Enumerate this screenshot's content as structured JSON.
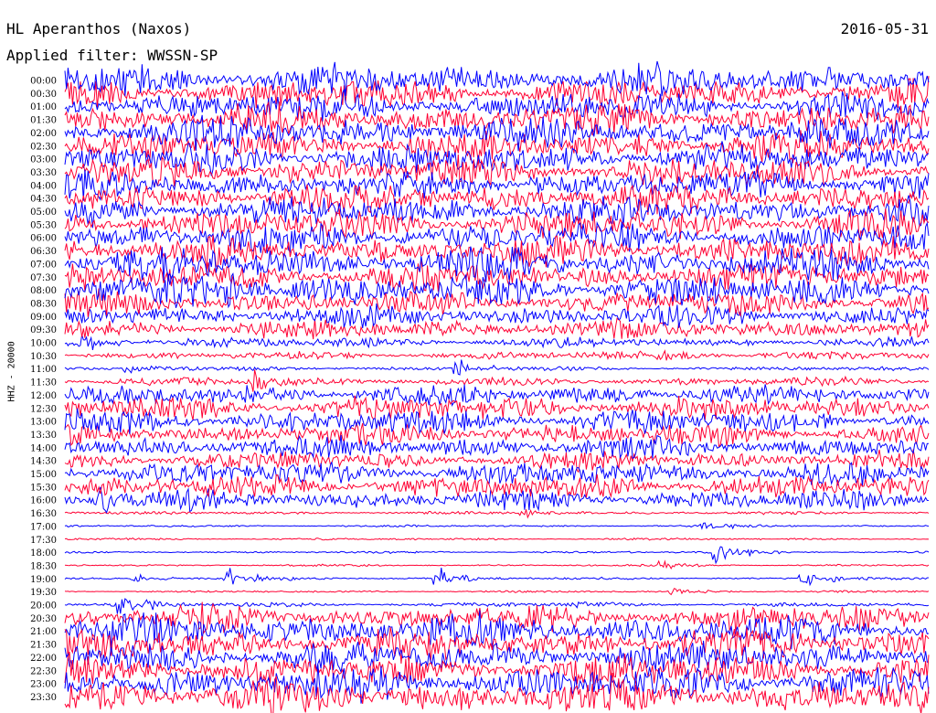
{
  "header": {
    "station": "HL Aperanthos (Naxos)",
    "date": "2016-05-31",
    "filter": "Applied filter: WWSSN-SP"
  },
  "chart_data": {
    "type": "line",
    "title": "HL Aperanthos (Naxos)",
    "ylabel": "HHZ - 20000",
    "colors": [
      "#0000ff",
      "#ff0033"
    ],
    "x_axis": "minutes within 30-minute trace line (0-30)",
    "grid": false,
    "legend": "none",
    "categories": [
      "00:00",
      "00:30",
      "01:00",
      "01:30",
      "02:00",
      "02:30",
      "03:00",
      "03:30",
      "04:00",
      "04:30",
      "05:00",
      "05:30",
      "06:00",
      "06:30",
      "07:00",
      "07:30",
      "08:00",
      "08:30",
      "09:00",
      "09:30",
      "10:00",
      "10:30",
      "11:00",
      "11:30",
      "12:00",
      "12:30",
      "13:00",
      "13:30",
      "14:00",
      "14:30",
      "15:00",
      "15:30",
      "16:00",
      "16:30",
      "17:00",
      "17:30",
      "18:00",
      "18:30",
      "19:00",
      "19:30",
      "20:00",
      "20:30",
      "21:00",
      "21:30",
      "22:00",
      "22:30",
      "23:00",
      "23:30"
    ],
    "noise_level": [
      1.6,
      1.5,
      1.5,
      1.5,
      1.6,
      1.5,
      1.5,
      1.5,
      1.5,
      1.5,
      1.5,
      1.5,
      1.5,
      1.5,
      1.6,
      1.5,
      1.6,
      1.2,
      1.1,
      1.0,
      0.5,
      0.4,
      0.2,
      0.4,
      1.0,
      1.2,
      1.2,
      1.1,
      1.1,
      0.9,
      1.2,
      1.2,
      1.0,
      0.15,
      0.1,
      0.1,
      0.1,
      0.1,
      0.1,
      0.1,
      0.2,
      1.3,
      1.6,
      1.6,
      1.6,
      1.6,
      1.7,
      1.8
    ],
    "events": [
      {
        "line": "08:00",
        "start_min": 5.5,
        "amplitude": 1.5
      },
      {
        "line": "10:00",
        "start_min": 0.5,
        "amplitude": 1.2
      },
      {
        "line": "10:30",
        "start_min": 20.5,
        "amplitude": 0.8
      },
      {
        "line": "11:00",
        "start_min": 2.0,
        "amplitude": 1.0
      },
      {
        "line": "11:00",
        "start_min": 13.5,
        "amplitude": 1.1
      },
      {
        "line": "11:30",
        "start_min": 6.5,
        "amplitude": 1.4
      },
      {
        "line": "16:00",
        "start_min": 1.0,
        "amplitude": 1.6
      },
      {
        "line": "16:30",
        "start_min": 15.8,
        "amplitude": 0.5
      },
      {
        "line": "17:00",
        "start_min": 22.0,
        "amplitude": 0.6
      },
      {
        "line": "18:00",
        "start_min": 22.4,
        "amplitude": 1.8
      },
      {
        "line": "18:30",
        "start_min": 20.6,
        "amplitude": 0.5
      },
      {
        "line": "19:00",
        "start_min": 2.3,
        "amplitude": 0.6
      },
      {
        "line": "19:00",
        "start_min": 5.5,
        "amplitude": 1.6
      },
      {
        "line": "19:00",
        "start_min": 12.8,
        "amplitude": 1.6
      },
      {
        "line": "19:00",
        "start_min": 25.5,
        "amplitude": 1.3
      },
      {
        "line": "19:30",
        "start_min": 21.0,
        "amplitude": 0.5
      },
      {
        "line": "20:00",
        "start_min": 1.8,
        "amplitude": 1.8
      },
      {
        "line": "20:00",
        "start_min": 17.7,
        "amplitude": 0.4
      },
      {
        "line": "20:30",
        "start_min": 23.0,
        "amplitude": 1.3
      }
    ]
  }
}
